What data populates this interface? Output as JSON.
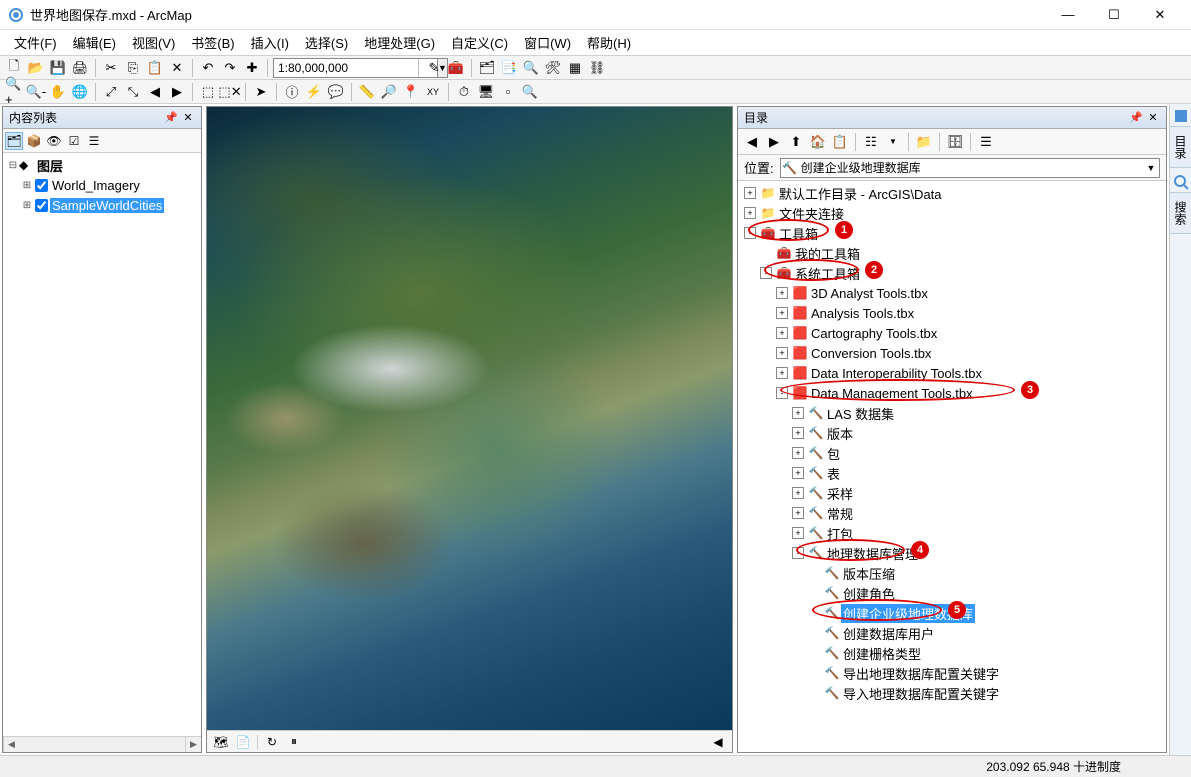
{
  "title": "世界地图保存.mxd - ArcMap",
  "menus": [
    "文件(F)",
    "编辑(E)",
    "视图(V)",
    "书签(B)",
    "插入(I)",
    "选择(S)",
    "地理处理(G)",
    "自定义(C)",
    "窗口(W)",
    "帮助(H)"
  ],
  "scale": "1:80,000,000",
  "toc": {
    "title": "内容列表",
    "root": "图层",
    "layers": [
      {
        "name": "World_Imagery",
        "checked": true
      },
      {
        "name": "SampleWorldCities",
        "checked": true,
        "selected": true
      }
    ]
  },
  "catalog": {
    "title": "目录",
    "location_label": "位置:",
    "location_value": "创建企业级地理数据库",
    "items": [
      {
        "ind": 0,
        "exp": "+",
        "icon": "📁",
        "label": "默认工作目录 - ArcGIS\\Data"
      },
      {
        "ind": 0,
        "exp": "+",
        "icon": "📁",
        "label": "文件夹连接"
      },
      {
        "ind": 0,
        "exp": "-",
        "icon": "🧰",
        "label": "工具箱",
        "anno": 1
      },
      {
        "ind": 1,
        "exp": "",
        "icon": "🧰",
        "label": "我的工具箱"
      },
      {
        "ind": 1,
        "exp": "-",
        "icon": "🧰",
        "label": "系统工具箱",
        "anno": 2
      },
      {
        "ind": 2,
        "exp": "+",
        "icon": "🟥",
        "label": "3D Analyst Tools.tbx"
      },
      {
        "ind": 2,
        "exp": "+",
        "icon": "🟥",
        "label": "Analysis Tools.tbx"
      },
      {
        "ind": 2,
        "exp": "+",
        "icon": "🟥",
        "label": "Cartography Tools.tbx"
      },
      {
        "ind": 2,
        "exp": "+",
        "icon": "🟥",
        "label": "Conversion Tools.tbx"
      },
      {
        "ind": 2,
        "exp": "+",
        "icon": "🟥",
        "label": "Data Interoperability Tools.tbx"
      },
      {
        "ind": 2,
        "exp": "-",
        "icon": "🟥",
        "label": "Data Management Tools.tbx",
        "anno": 3
      },
      {
        "ind": 3,
        "exp": "+",
        "icon": "🔨",
        "label": "LAS 数据集"
      },
      {
        "ind": 3,
        "exp": "+",
        "icon": "🔨",
        "label": "版本"
      },
      {
        "ind": 3,
        "exp": "+",
        "icon": "🔨",
        "label": "包"
      },
      {
        "ind": 3,
        "exp": "+",
        "icon": "🔨",
        "label": "表"
      },
      {
        "ind": 3,
        "exp": "+",
        "icon": "🔨",
        "label": "采样"
      },
      {
        "ind": 3,
        "exp": "+",
        "icon": "🔨",
        "label": "常规"
      },
      {
        "ind": 3,
        "exp": "+",
        "icon": "🔨",
        "label": "打包"
      },
      {
        "ind": 3,
        "exp": "-",
        "icon": "🔨",
        "label": "地理数据库管理",
        "anno": 4
      },
      {
        "ind": 4,
        "exp": "",
        "icon": "🔨",
        "label": "版本压缩"
      },
      {
        "ind": 4,
        "exp": "",
        "icon": "🔨",
        "label": "创建角色"
      },
      {
        "ind": 4,
        "exp": "",
        "icon": "🔨",
        "label": "创建企业级地理数据库",
        "selected": true,
        "anno": 5
      },
      {
        "ind": 4,
        "exp": "",
        "icon": "🔨",
        "label": "创建数据库用户"
      },
      {
        "ind": 4,
        "exp": "",
        "icon": "🔨",
        "label": "创建栅格类型"
      },
      {
        "ind": 4,
        "exp": "",
        "icon": "🔨",
        "label": "导出地理数据库配置关键字"
      },
      {
        "ind": 4,
        "exp": "",
        "icon": "🔨",
        "label": "导入地理数据库配置关键字"
      }
    ]
  },
  "sidetabs": [
    "目录",
    "搜索"
  ],
  "status_coords": "203.092 65.948 十进制度"
}
